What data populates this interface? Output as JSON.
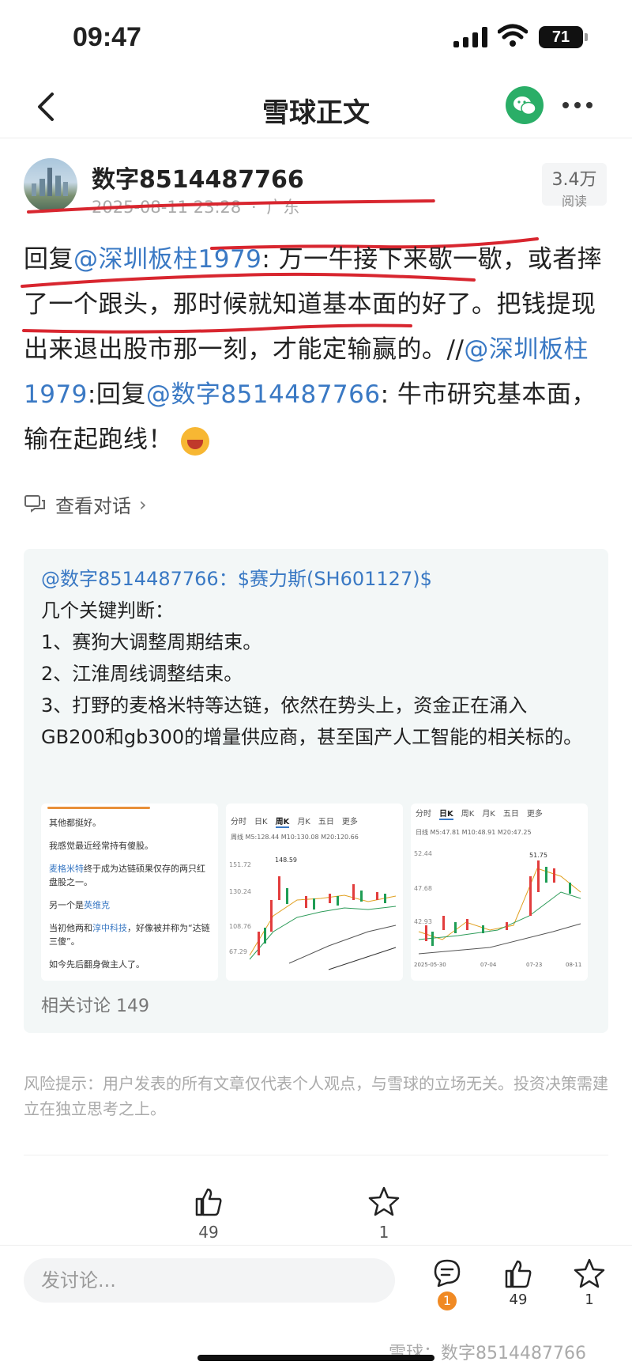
{
  "status": {
    "time": "09:47",
    "battery": "71"
  },
  "nav": {
    "title": "雪球正文"
  },
  "author": {
    "name": "数字8514487766",
    "datetime": "2025-08-11 23:28",
    "location": "广东",
    "separator": "·",
    "reads_count": "3.4万",
    "reads_label": "阅读"
  },
  "post": {
    "p1": "回复",
    "m1": "@深圳板柱1979",
    "p2": ": 万一牛接下来歇一歇，或者摔了一个跟头，那时候就知道基本面的好了。把钱提现出来退出股市那一刻，才能定输赢的。//",
    "m2": "@深圳板柱1979",
    "p3": ":回复",
    "m3": "@数字8514487766",
    "p4": ": 牛市研究基本面，输在起跑线！"
  },
  "view_conversation": "查看对话",
  "quote": {
    "header": "@数字8514487766：$赛力斯(SH601127)$",
    "lines": [
      "几个关键判断：",
      "1、赛狗大调整周期结束。",
      "2、江淮周线调整结束。",
      "3、打野的麦格米特等达链，依然在势头上，资金正在涌入GB200和gb300的增量供应商，甚至国产人工智能的相关标的。"
    ],
    "related": "相关讨论 149"
  },
  "thumb1": {
    "l1": "其他都挺好。",
    "l2": "我感觉最近经常持有傻股。",
    "l3a": "麦格米特",
    "l3b": "终于成为达链硕果仅存的两只红盘股之一。",
    "l4a": "另一个是",
    "l4b": "英维克",
    "l5a": "当初他两和",
    "l5b": "淳中科技",
    "l5c": "，好像被并称为“达链三傻”。",
    "l6": "如今先后翻身做主人了。"
  },
  "thumb2": {
    "tabs": [
      "分时",
      "日K",
      "周K",
      "月K",
      "五日",
      "更多"
    ],
    "ma": "周线  M5:128.44  M10:130.08  M20:120.66",
    "p1": "151.72",
    "p2": "130.24",
    "p3": "108.76",
    "p4": "67.29",
    "peak": "148.59"
  },
  "thumb3": {
    "tabs": [
      "分时",
      "日K",
      "周K",
      "月K",
      "五日",
      "更多"
    ],
    "ma": "日线  M5:47.81  M10:48.91  M20:47.25",
    "p1": "52.44",
    "p2": "47.68",
    "p3": "42.93",
    "d1": "2025-05-30",
    "d2": "07-04",
    "d3": "07-23",
    "d4": "08-11",
    "peak": "51.75"
  },
  "risk": "风险提示：用户发表的所有文章仅代表个人观点，与雪球的立场无关。投资决策需建立在独立思考之上。",
  "actions": {
    "like_count": "49",
    "fav_count": "1"
  },
  "bottom": {
    "placeholder": "发讨论...",
    "comment_badge": "1",
    "like_count": "49",
    "fav_count": "1",
    "watermark": "雪球：数字8514487766"
  }
}
